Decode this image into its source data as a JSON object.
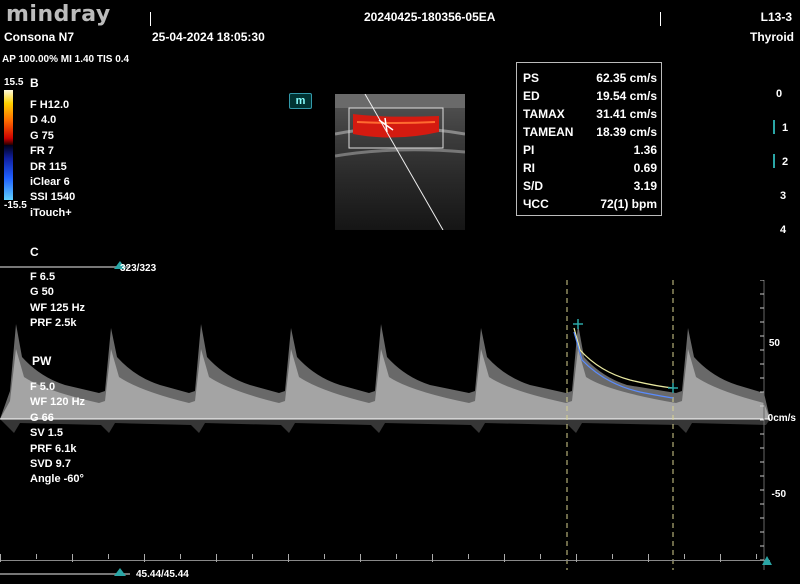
{
  "header": {
    "brand": "mindray",
    "model": "Consona N7",
    "datetime": "25-04-2024  18:05:30",
    "exam_id": "20240425-180356-05EA",
    "probe": "L13-3",
    "preset": "Thyroid",
    "acoustic": "AP 100.00%  MI 1.40 TIS 0.4"
  },
  "colorbar": {
    "top": "15.5",
    "bottom": "-15.5"
  },
  "bmode": {
    "label": "B",
    "params": [
      "F H12.0",
      "D 4.0",
      "G 75",
      "FR 7",
      "DR 115",
      "iClear 6",
      "SSI 1540",
      "iTouch+"
    ]
  },
  "color": {
    "label": "C",
    "params": [
      "F 6.5",
      "G 50",
      "WF 125 Hz",
      "PRF 2.5k"
    ],
    "frame": "323/323"
  },
  "pw": {
    "label": "PW",
    "params": [
      "F 5.0",
      "WF 120 Hz",
      "G 66",
      "SV 1.5",
      "PRF 6.1k",
      "SVD 9.7",
      "Angle   -60°"
    ],
    "frame": "45.44/45.44"
  },
  "m_icon": "m",
  "measurements": [
    {
      "label": "PS",
      "value": "62.35 cm/s"
    },
    {
      "label": "ED",
      "value": "19.54 cm/s"
    },
    {
      "label": "TAMAX",
      "value": "31.41 cm/s"
    },
    {
      "label": "TAMEAN",
      "value": "18.39 cm/s"
    },
    {
      "label": "PI",
      "value": "1.36"
    },
    {
      "label": "RI",
      "value": "0.69"
    },
    {
      "label": "S/D",
      "value": "3.19"
    },
    {
      "label": "ЧСС",
      "value": "72(1) bpm"
    }
  ],
  "depth_scale": [
    "0",
    "1",
    "2",
    "3",
    "4"
  ],
  "velocity_scale": {
    "top": "50",
    "zero": "0cm/s",
    "bottom": "-50"
  },
  "colors": {
    "accent": "#2aa6a6",
    "flow": "#d41a10",
    "trace": "#e8e8a0"
  }
}
